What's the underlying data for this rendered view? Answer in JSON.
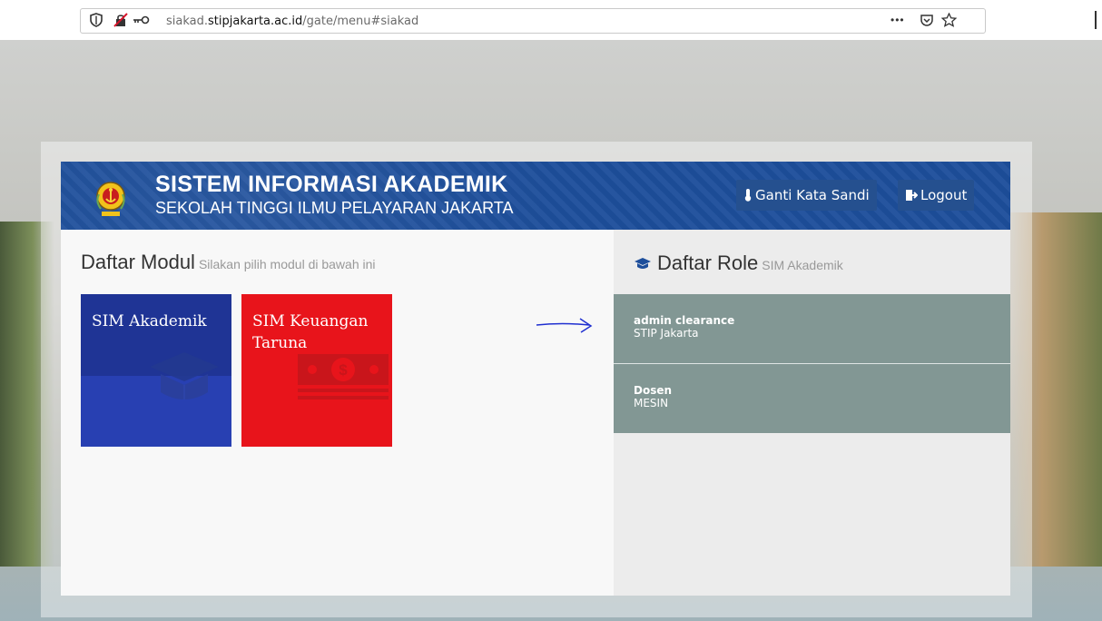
{
  "browser": {
    "url_prefix": "siakad.",
    "url_domain": "stipjakarta.ac.id",
    "url_path": "/gate/menu#siakad",
    "page_actions": "•••"
  },
  "header": {
    "title": "SISTEM INFORMASI AKADEMIK",
    "subtitle": "SEKOLAH TINGGI ILMU PELAYARAN JAKARTA",
    "change_password_label": "Ganti Kata Sandi",
    "logout_label": "Logout"
  },
  "modules": {
    "heading": "Daftar Modul",
    "hint": "Silakan pilih modul di bawah ini",
    "items": [
      {
        "label": "SIM Akademik",
        "icon": "graduation-cap-icon",
        "color": "#2840b2"
      },
      {
        "label": "SIM Keuangan Taruna",
        "icon": "money-icon",
        "color": "#e8141b"
      }
    ]
  },
  "roles": {
    "heading": "Daftar Role",
    "context": "SIM Akademik",
    "items": [
      {
        "name": "admin clearance",
        "unit": "STIP Jakarta"
      },
      {
        "name": "Dosen",
        "unit": "MESIN"
      }
    ]
  },
  "colors": {
    "header_blue": "#1d4e9b",
    "tile_blue": "#2840b2",
    "tile_red": "#e8141b",
    "role_bg": "#829794"
  }
}
